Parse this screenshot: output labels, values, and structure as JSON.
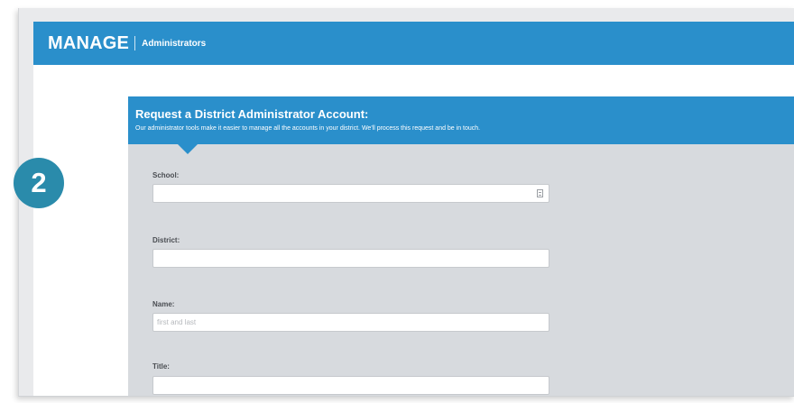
{
  "header": {
    "brand": "MANAGE",
    "section": "Administrators"
  },
  "step_badge": "2",
  "form": {
    "title": "Request a District Administrator Account:",
    "description": "Our administrator tools make it easier to manage all the accounts in your district. We'll process this request and be in touch.",
    "fields": [
      {
        "label": "School:",
        "value": "",
        "placeholder": "",
        "icon": "list-icon"
      },
      {
        "label": "District:",
        "value": "",
        "placeholder": ""
      },
      {
        "label": "Name:",
        "value": "",
        "placeholder": "first and last"
      },
      {
        "label": "Title:",
        "value": "",
        "placeholder": ""
      }
    ]
  },
  "colors": {
    "brand_blue": "#2a8fcb",
    "panel_gray": "#d7dade",
    "badge_teal": "#2a8bab"
  }
}
